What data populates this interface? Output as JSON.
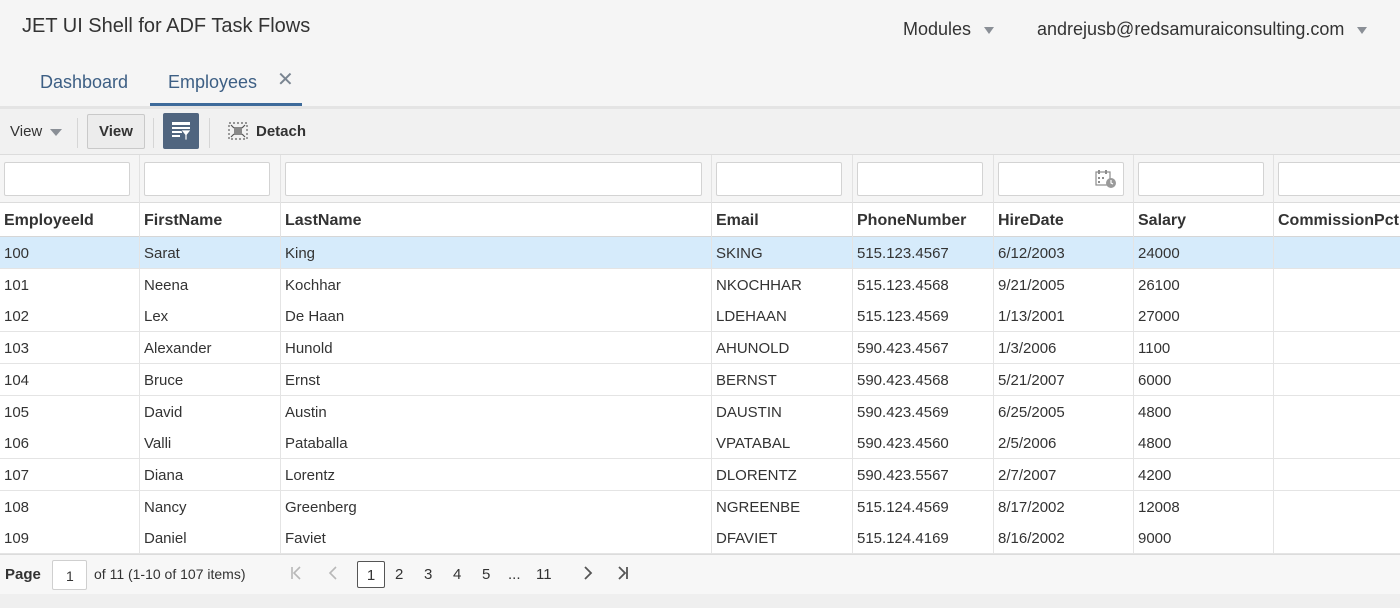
{
  "app": {
    "title": "JET UI Shell for ADF Task Flows",
    "modules_label": "Modules",
    "user_label": "andrejusb@redsamuraiconsulting.com"
  },
  "tabs": [
    {
      "label": "Dashboard",
      "active": false
    },
    {
      "label": "Employees",
      "active": true,
      "closable": true,
      "close_glyph": "✕"
    }
  ],
  "toolbar": {
    "view_menu_label": "View",
    "view_button_label": "View",
    "filter_icon": "query-filter-icon",
    "detach_label": "Detach"
  },
  "table": {
    "columns": [
      "EmployeeId",
      "FirstName",
      "LastName",
      "Email",
      "PhoneNumber",
      "HireDate",
      "Salary",
      "CommissionPct"
    ],
    "selected_row": 0,
    "rows": [
      [
        "100",
        "Sarat",
        "King",
        "SKING",
        "515.123.4567",
        "6/12/2003",
        "24000",
        ""
      ],
      [
        "101",
        "Neena",
        "Kochhar",
        "NKOCHHAR",
        "515.123.4568",
        "9/21/2005",
        "26100",
        ""
      ],
      [
        "102",
        "Lex",
        "De Haan",
        "LDEHAAN",
        "515.123.4569",
        "1/13/2001",
        "27000",
        ""
      ],
      [
        "103",
        "Alexander",
        "Hunold",
        "AHUNOLD",
        "590.423.4567",
        "1/3/2006",
        "1100",
        ""
      ],
      [
        "104",
        "Bruce",
        "Ernst",
        "BERNST",
        "590.423.4568",
        "5/21/2007",
        "6000",
        ""
      ],
      [
        "105",
        "David",
        "Austin",
        "DAUSTIN",
        "590.423.4569",
        "6/25/2005",
        "4800",
        ""
      ],
      [
        "106",
        "Valli",
        "Pataballa",
        "VPATABAL",
        "590.423.4560",
        "2/5/2006",
        "4800",
        ""
      ],
      [
        "107",
        "Diana",
        "Lorentz",
        "DLORENTZ",
        "590.423.5567",
        "2/7/2007",
        "4200",
        ""
      ],
      [
        "108",
        "Nancy",
        "Greenberg",
        "NGREENBE",
        "515.124.4569",
        "8/17/2002",
        "12008",
        ""
      ],
      [
        "109",
        "Daniel",
        "Faviet",
        "DFAVIET",
        "515.124.4169",
        "8/16/2002",
        "9000",
        ""
      ]
    ]
  },
  "pager": {
    "page_label": "Page",
    "page_value": "1",
    "info": "of 11 (1-10 of 107 items)",
    "pages": [
      "1",
      "2",
      "3",
      "4",
      "5",
      "...",
      "11"
    ],
    "current_page": "1"
  },
  "colors": {
    "tab_text": "#3d5f84",
    "selected_row": "#d6ebfb",
    "filter_button": "#50657f"
  }
}
